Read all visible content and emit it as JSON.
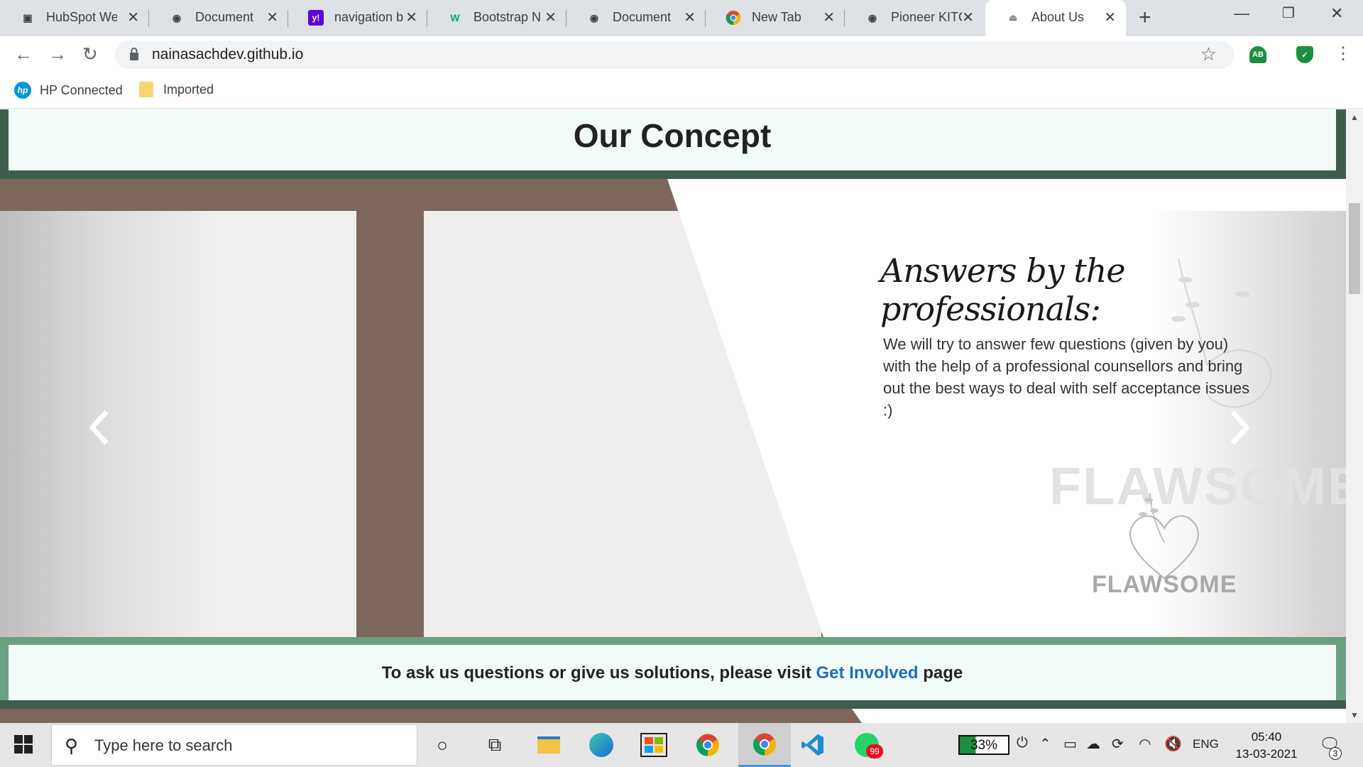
{
  "browser": {
    "tabs": [
      {
        "title": "HubSpot We",
        "icon": "hubspot-icon"
      },
      {
        "title": "Document",
        "icon": "globe-icon"
      },
      {
        "title": "navigation b",
        "icon": "yahoo-icon"
      },
      {
        "title": "Bootstrap N",
        "icon": "w3-icon"
      },
      {
        "title": "Document",
        "icon": "globe-icon"
      },
      {
        "title": "New Tab",
        "icon": "chrome-icon"
      },
      {
        "title": "Pioneer KITC",
        "icon": "globe-icon"
      },
      {
        "title": "About Us",
        "icon": "page-icon"
      }
    ],
    "active_tab": 7,
    "url": "nainasachdev.github.io",
    "extensions": [
      {
        "label": "AB",
        "color": "#1e8e3e"
      },
      {
        "label": "✓",
        "color": "#1e8e3e"
      }
    ],
    "bookmarks": [
      {
        "label": "HP Connected",
        "icon": "hp-icon"
      },
      {
        "label": "Imported",
        "icon": "folder-icon"
      }
    ]
  },
  "page": {
    "concept_title": "Our Concept",
    "slide": {
      "heading": "Answers by the professionals:",
      "caption": "We will try to answer few questions (given by you) with the help of a professional counsellors and bring out the best ways to deal with self acceptance issues :)",
      "watermark": "FLAWSOME",
      "logo_text": "FLAWSOME"
    },
    "info": {
      "prefix": "To ask us questions or give us solutions, please visit ",
      "link": "Get Involved",
      "suffix": " page"
    },
    "colors": {
      "dark_green": "#3e5e4d",
      "sage_green": "#6b9f82",
      "mint_bg": "#f2fcf8",
      "brown": "#7d675d",
      "link_blue": "#1e6fb8"
    }
  },
  "taskbar": {
    "search_placeholder": "Type here to search",
    "battery": "33%",
    "language": "ENG",
    "time": "05:40",
    "date": "13-03-2021",
    "notifications": "3",
    "whatsapp_badge": "99"
  }
}
